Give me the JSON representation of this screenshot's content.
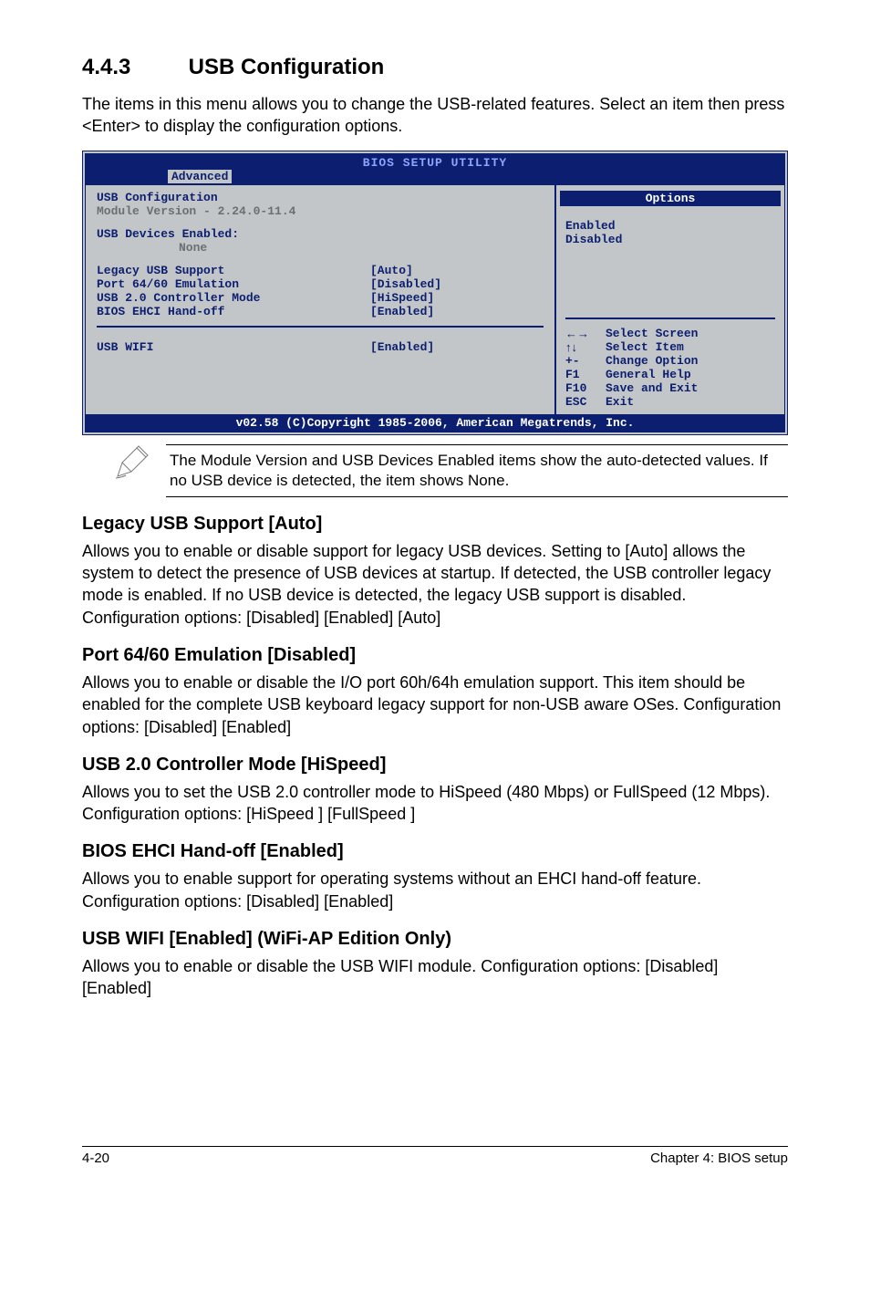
{
  "section": {
    "number": "4.4.3",
    "title": "USB Configuration"
  },
  "intro": "The items in this menu allows you to change the USB-related features. Select an item then press <Enter> to display the configuration options.",
  "bios": {
    "banner": "BIOS SETUP UTILITY",
    "tab_active": "Advanced",
    "heading": "USB Configuration",
    "module_line": "Module Version - 2.24.0-11.4",
    "devices_hdr": "USB Devices Enabled:",
    "devices_val": "None",
    "items": [
      {
        "label": "Legacy USB Support",
        "value": "[Auto]"
      },
      {
        "label": "Port 64/60 Emulation",
        "value": "[Disabled]"
      },
      {
        "label": "USB 2.0 Controller Mode",
        "value": "[HiSpeed]"
      },
      {
        "label": "BIOS EHCI Hand-off",
        "value": "[Enabled]"
      }
    ],
    "wifi": {
      "label": "USB WIFI",
      "value": "[Enabled]"
    },
    "options_hdr": "Options",
    "options": {
      "o1": "Enabled",
      "o2": "Disabled"
    },
    "help": {
      "h1": "Select Screen",
      "h2": "Select Item",
      "h3k": "+-",
      "h3": "Change Option",
      "h4k": "F1",
      "h4": "General Help",
      "h5k": "F10",
      "h5": "Save and Exit",
      "h6k": "ESC",
      "h6": "Exit"
    },
    "footer": "v02.58 (C)Copyright 1985-2006, American Megatrends, Inc."
  },
  "note": "The Module Version and USB Devices Enabled items show the auto-detected values. If no USB device is detected, the item shows None.",
  "subsections": {
    "s1h": "Legacy USB Support [Auto]",
    "s1b": "Allows you to enable or disable support for legacy USB devices. Setting to [Auto] allows the system to detect the presence of USB devices at startup. If detected, the USB controller legacy mode is enabled. If no USB device is detected, the legacy USB support is disabled. Configuration options: [Disabled] [Enabled] [Auto]",
    "s2h": "Port 64/60 Emulation [Disabled]",
    "s2b": "Allows you to enable or disable the I/O port 60h/64h emulation support. This item should be enabled for the complete USB keyboard legacy support for non-USB aware OSes. Configuration options: [Disabled] [Enabled]",
    "s3h": "USB 2.0 Controller Mode [HiSpeed]",
    "s3b": "Allows you to set the USB 2.0 controller mode to HiSpeed (480 Mbps) or FullSpeed (12 Mbps). Configuration options: [HiSpeed ] [FullSpeed ]",
    "s4h": "BIOS EHCI Hand-off [Enabled]",
    "s4b": "Allows you to enable support for operating systems without an EHCI hand-off feature. Configuration options: [Disabled] [Enabled]",
    "s5h": "USB WIFI [Enabled] (WiFi-AP Edition Only)",
    "s5b": "Allows you to enable or disable the USB WIFI module. Configuration options: [Disabled] [Enabled]"
  },
  "footer": {
    "left": "4-20",
    "right": "Chapter 4: BIOS setup"
  }
}
